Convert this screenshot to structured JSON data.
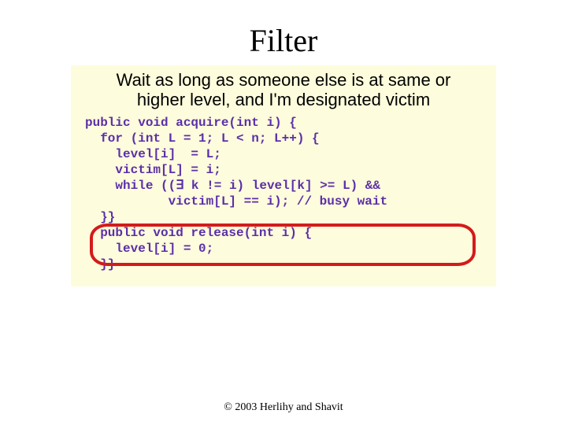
{
  "title": "Filter",
  "explain_line1": "Wait as long as someone else is at same or",
  "explain_line2": "higher level, and I'm designated victim",
  "code": {
    "l1": "public void acquire(int i) {",
    "l2": "  for (int L = 1; L < n; L++) {",
    "l3": "    level[i]  = L;",
    "l4": "    victim[L] = i;",
    "l5a": "    while ((",
    "l5b": "∃",
    "l5c": " k != i) level[k] >= L) &&",
    "l6": "           victim[L] == i); // busy wait",
    "l7": "  }}",
    "l8": "  public void release(int i) {",
    "l9": "    level[i] = 0;",
    "l10": "  }}"
  },
  "footer": "© 2003 Herlihy and Shavit"
}
